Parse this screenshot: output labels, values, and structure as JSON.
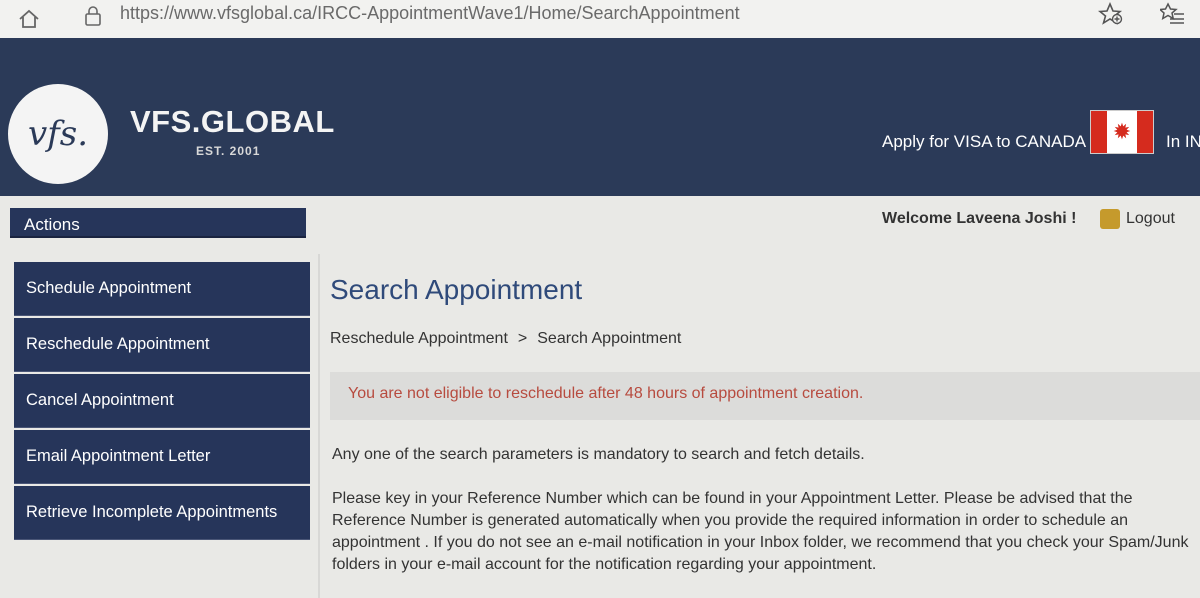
{
  "browser": {
    "url": "https://www.vfsglobal.ca/IRCC-AppointmentWave1/Home/SearchAppointment",
    "icons": [
      "home-icon",
      "lock-icon",
      "add-favorite-icon",
      "favorites-list-icon"
    ]
  },
  "header": {
    "logo_text": "vfs.",
    "brand_name": "VFS.GLOBAL",
    "brand_est": "EST. 2001",
    "apply_text": "Apply for VISA to CANADA",
    "lang_text": "In IN",
    "colors": {
      "header_bg": "#2b3a58",
      "flag_red": "#d52b1e"
    }
  },
  "sidebar": {
    "title": "Actions",
    "items": [
      {
        "label": "Schedule Appointment"
      },
      {
        "label": "Reschedule Appointment"
      },
      {
        "label": "Cancel Appointment"
      },
      {
        "label": "Email Appointment Letter"
      },
      {
        "label": "Retrieve Incomplete Appointments"
      }
    ]
  },
  "user": {
    "welcome": "Welcome Laveena Joshi !",
    "logout": "Logout"
  },
  "main": {
    "title": "Search Appointment",
    "breadcrumb": {
      "parent": "Reschedule Appointment",
      "separator": ">",
      "current": "Search Appointment"
    },
    "alert": "You are not eligible to reschedule after 48 hours of appointment creation.",
    "mandatory": "Any one of the search parameters is mandatory to search and fetch details.",
    "paragraph": "Please key in your Reference Number which can be found in your Appointment Letter. Please be advised that the Reference Number is generated automatically when you provide the required information in order to schedule an appointment . If you do not see an e-mail notification in your Inbox folder, we recommend that you check your Spam/Junk folders in your e-mail account for the notification regarding your appointment."
  }
}
